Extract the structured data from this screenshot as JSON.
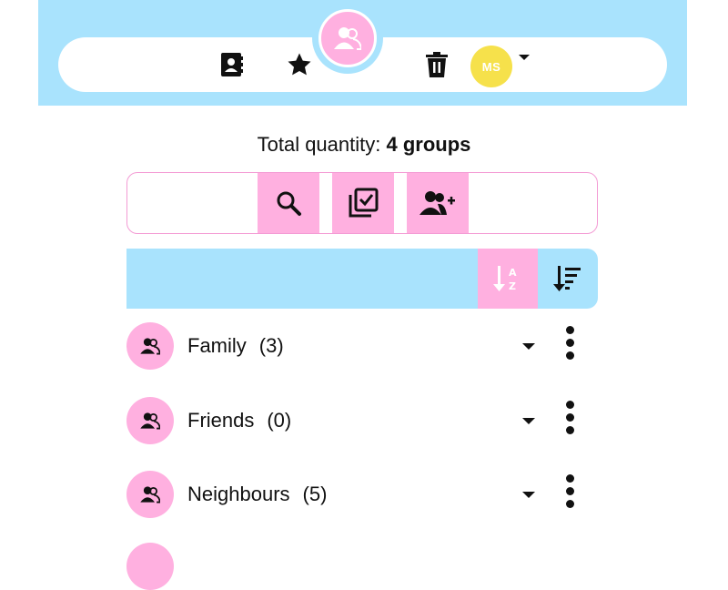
{
  "header": {
    "nav_icons": [
      "address-book-icon",
      "star-icon",
      "trash-icon"
    ],
    "center_icon": "users-icon",
    "user": {
      "initials": "MS",
      "badge_color": "#f6e14b"
    },
    "bar_color": "#a9e3fd",
    "accent_color": "#ffb0e0"
  },
  "summary": {
    "label": "Total quantity:",
    "value": "4 groups"
  },
  "toolbar": {
    "buttons": [
      "search-icon",
      "select-multiple-icon",
      "add-user-icon"
    ]
  },
  "sortbar": {
    "buttons": [
      "sort-alpha-icon",
      "sort-list-icon"
    ]
  },
  "groups": [
    {
      "name": "Family",
      "count": "(3)"
    },
    {
      "name": "Friends",
      "count": "(0)"
    },
    {
      "name": "Neighbours",
      "count": "(5)"
    }
  ]
}
